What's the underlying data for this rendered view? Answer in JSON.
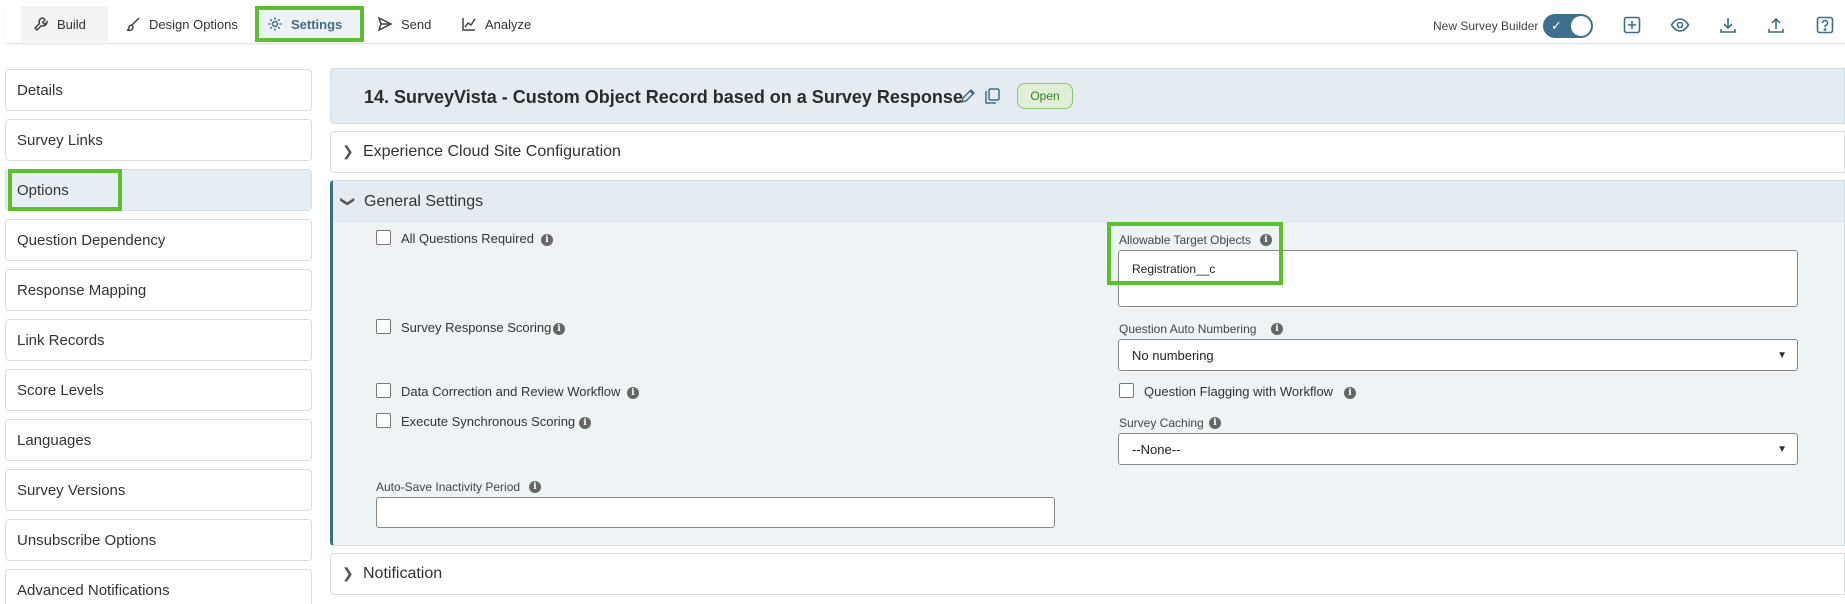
{
  "toolbar": {
    "tabs": [
      {
        "label": "Build",
        "icon": "wrench-icon"
      },
      {
        "label": "Design Options",
        "icon": "brush-icon"
      },
      {
        "label": "Settings",
        "icon": "gear-icon"
      },
      {
        "label": "Send",
        "icon": "send-icon"
      },
      {
        "label": "Analyze",
        "icon": "chart-icon"
      }
    ],
    "builder_label": "New Survey Builder",
    "builder_enabled": true,
    "tool_icons": [
      "add-icon",
      "preview-eye-icon",
      "download-icon",
      "upload-icon",
      "help-icon"
    ]
  },
  "sidebar": {
    "items": [
      {
        "label": "Details"
      },
      {
        "label": "Survey Links"
      },
      {
        "label": "Options",
        "active": true
      },
      {
        "label": "Question Dependency"
      },
      {
        "label": "Response Mapping"
      },
      {
        "label": "Link Records"
      },
      {
        "label": "Score Levels"
      },
      {
        "label": "Languages"
      },
      {
        "label": "Survey Versions"
      },
      {
        "label": "Unsubscribe Options"
      },
      {
        "label": "Advanced Notifications"
      }
    ]
  },
  "survey": {
    "title": "14. SurveyVista - Custom Object Record based on a Survey Response",
    "status": "Open"
  },
  "sections": {
    "experience": "Experience Cloud Site Configuration",
    "general": "General Settings",
    "notification": "Notification"
  },
  "general": {
    "all_questions_required": "All Questions Required",
    "survey_response_scoring": "Survey Response Scoring",
    "data_correction": "Data Correction and Review Workflow",
    "execute_sync_scoring": "Execute Synchronous Scoring",
    "auto_save_label": "Auto-Save Inactivity Period",
    "auto_save_value": "",
    "allowable_target_label": "Allowable Target Objects",
    "allowable_target_value": "Registration__c",
    "auto_numbering_label": "Question Auto Numbering",
    "auto_numbering_value": "No numbering",
    "question_flagging": "Question Flagging with Workflow",
    "caching_label": "Survey Caching",
    "caching_value": "--None--"
  },
  "colors": {
    "accent": "#3f6d86",
    "highlight": "#5bbf2e",
    "badge_bg": "#dff0d6"
  }
}
